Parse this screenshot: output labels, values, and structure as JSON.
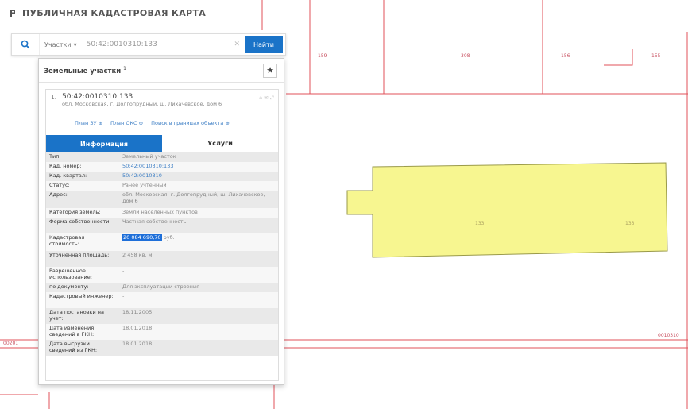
{
  "app": {
    "title": "ПУБЛИЧНАЯ КАДАСТРОВАЯ КАРТА"
  },
  "search": {
    "type_label": "Участки",
    "value": "50:42:0010310:133",
    "clear": "✕",
    "button_label": "Найти"
  },
  "results": {
    "title": "Земельные участки",
    "count": "1"
  },
  "parcel": {
    "index": "1.",
    "number": "50:42:0010310:133",
    "address": "обл. Московская, г. Долгопрудный, ш. Лихачевское, дом 6",
    "controls": "⌂ ✉ ⤢",
    "links": [
      "План ЗУ ⊕",
      "План ОКС ⊕",
      "Поиск в границах объекта ⊕"
    ]
  },
  "tabs": {
    "info": "Информация",
    "services": "Услуги"
  },
  "attributes": [
    {
      "key": "Тип:",
      "value": "Земельный участок"
    },
    {
      "key": "Кад. номер:",
      "value": "50:42:0010310:133",
      "link": true
    },
    {
      "key": "Кад. квартал:",
      "value": "50:42:0010310",
      "link": true
    },
    {
      "key": "Статус:",
      "value": "Ранее учтенный"
    },
    {
      "key": "Адрес:",
      "value": "обл. Московская, г. Долгопрудный, ш. Лихачевское, дом 6"
    },
    {
      "key": "Категория земель:",
      "value": "Земли населённых пунктов"
    },
    {
      "key": "Форма собственности:",
      "value": "Частная собственность"
    },
    {
      "key": "Кадастровая стоимость:",
      "value": "20 084 690,70",
      "suffix": " руб.",
      "highlight": true
    },
    {
      "key": "Уточненная площадь:",
      "value": "2 458 кв. м"
    },
    {
      "key": "Разрешенное использование:",
      "value": "-"
    },
    {
      "key": "по документу:",
      "value": "Для эксплуатации строения"
    },
    {
      "key": "Кадастровый инженер:",
      "value": "-"
    },
    {
      "key": "Дата постановки на учет:",
      "value": "18.11.2005"
    },
    {
      "key": "Дата изменения сведений в ГКН:",
      "value": "18.01.2018"
    },
    {
      "key": "Дата выгрузки сведений из ГКН:",
      "value": "18.01.2018"
    }
  ],
  "map": {
    "parcel_fill": "#f7f690",
    "parcel_stroke": "#9a9a4a",
    "boundary_color": "#e0505a",
    "labels": {
      "top_1": "159",
      "top_2": "308",
      "top_3": "156",
      "top_4": "155",
      "parcel_1": "133",
      "parcel_2": "133",
      "quarter_left": "00201",
      "quarter_right": "0010310"
    }
  }
}
